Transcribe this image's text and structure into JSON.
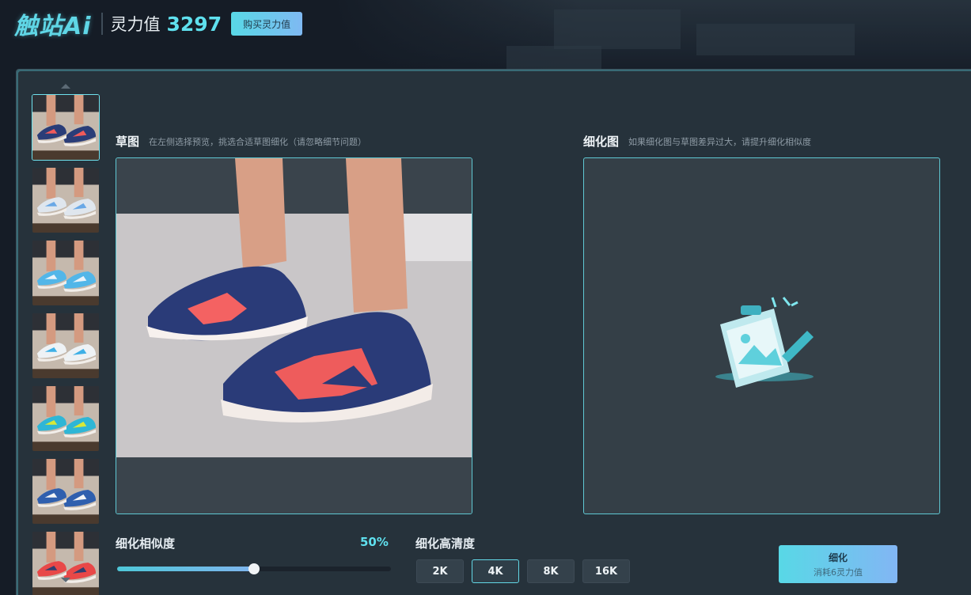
{
  "header": {
    "logo": "触站Ai",
    "lingli_label": "灵力值",
    "lingli_value": "3297",
    "buy_button": "购买灵力值"
  },
  "thumbnails": [
    {
      "name": "thumbnail-1",
      "selected": true,
      "shoe_color": "#2a3d78",
      "accent": "#f05a5a"
    },
    {
      "name": "thumbnail-2",
      "selected": false,
      "shoe_color": "#dfe6ee",
      "accent": "#6aa8e6"
    },
    {
      "name": "thumbnail-3",
      "selected": false,
      "shoe_color": "#52b6e8",
      "accent": "#eaf3fa"
    },
    {
      "name": "thumbnail-4",
      "selected": false,
      "shoe_color": "#eef2f5",
      "accent": "#3fb0e6"
    },
    {
      "name": "thumbnail-5",
      "selected": false,
      "shoe_color": "#2fb6d6",
      "accent": "#d8e838"
    },
    {
      "name": "thumbnail-6",
      "selected": false,
      "shoe_color": "#2f5fae",
      "accent": "#f2f4f6"
    },
    {
      "name": "thumbnail-7",
      "selected": false,
      "shoe_color": "#e84848",
      "accent": "#2e3f70"
    }
  ],
  "sketch": {
    "title": "草图",
    "hint": "在左侧选择预览，挑选合适草图细化（请忽略细节问题）"
  },
  "refined": {
    "title": "细化图",
    "hint": "如果细化图与草图差异过大，请提升细化相似度"
  },
  "similarity": {
    "label": "细化相似度",
    "value_text": "50%",
    "value": 0.5
  },
  "resolution": {
    "label": "细化高清度",
    "options": [
      "2K",
      "4K",
      "8K",
      "16K"
    ],
    "selected": "4K"
  },
  "refine_button": {
    "label": "细化",
    "sublabel": "消耗6灵力值"
  },
  "colors": {
    "accent": "#5fe0ee",
    "panel": "#26323b",
    "background": "#151c26"
  }
}
